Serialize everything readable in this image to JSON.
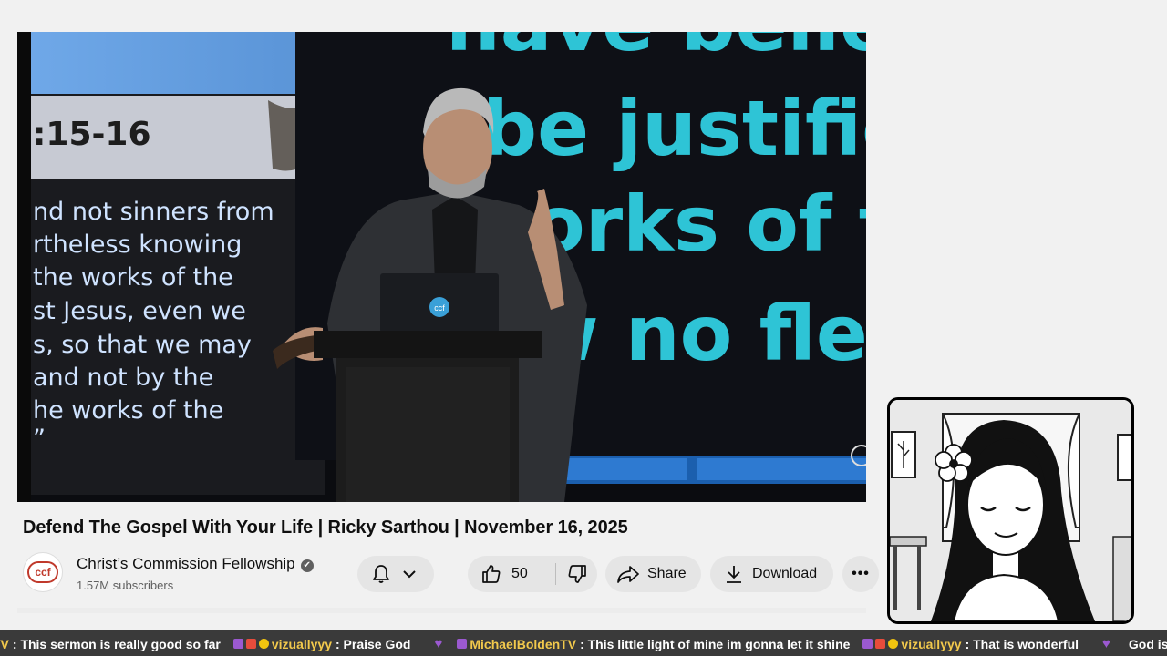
{
  "video": {
    "left_slide_ref": ":15-16",
    "left_slide_lines": [
      "nd not sinners from",
      "rtheless knowing",
      " the works of the",
      "st Jesus, even we",
      "s, so that we may",
      "and not by the",
      "he works of the",
      "”"
    ],
    "right_slide_lines": [
      "have believ",
      "be justified",
      "orks of th",
      "w no fles"
    ],
    "laptop_logo": "ccf"
  },
  "title": "Defend The Gospel With Your Life | Ricky Sarthou | November 16, 2025",
  "channel": {
    "avatar_logo": "ccf",
    "name": "Christ’s Commission Fellowship",
    "verified_icon": "✔",
    "subscribers": "1.57M subscribers"
  },
  "actions": {
    "likes": "50",
    "share": "Share",
    "download": "Download",
    "more": "•••"
  },
  "chat": [
    {
      "user": "TV",
      "text": ": This sermon is really good so far"
    },
    {
      "user": "vizuallyyy",
      "text": ": Praise God"
    },
    {
      "user": "MichaelBoldenTV",
      "text": ": This little light of mine im gonna let it shine"
    },
    {
      "user": "vizuallyyy",
      "text": ": That is wonderful"
    },
    {
      "user": "",
      "text": "God is smiling"
    }
  ],
  "colors": {
    "slide_text_cyan": "#2ec4d6",
    "ticker_bg": "#3a3a3a",
    "username": "#f2c94c",
    "heart": "#9b59d0"
  }
}
